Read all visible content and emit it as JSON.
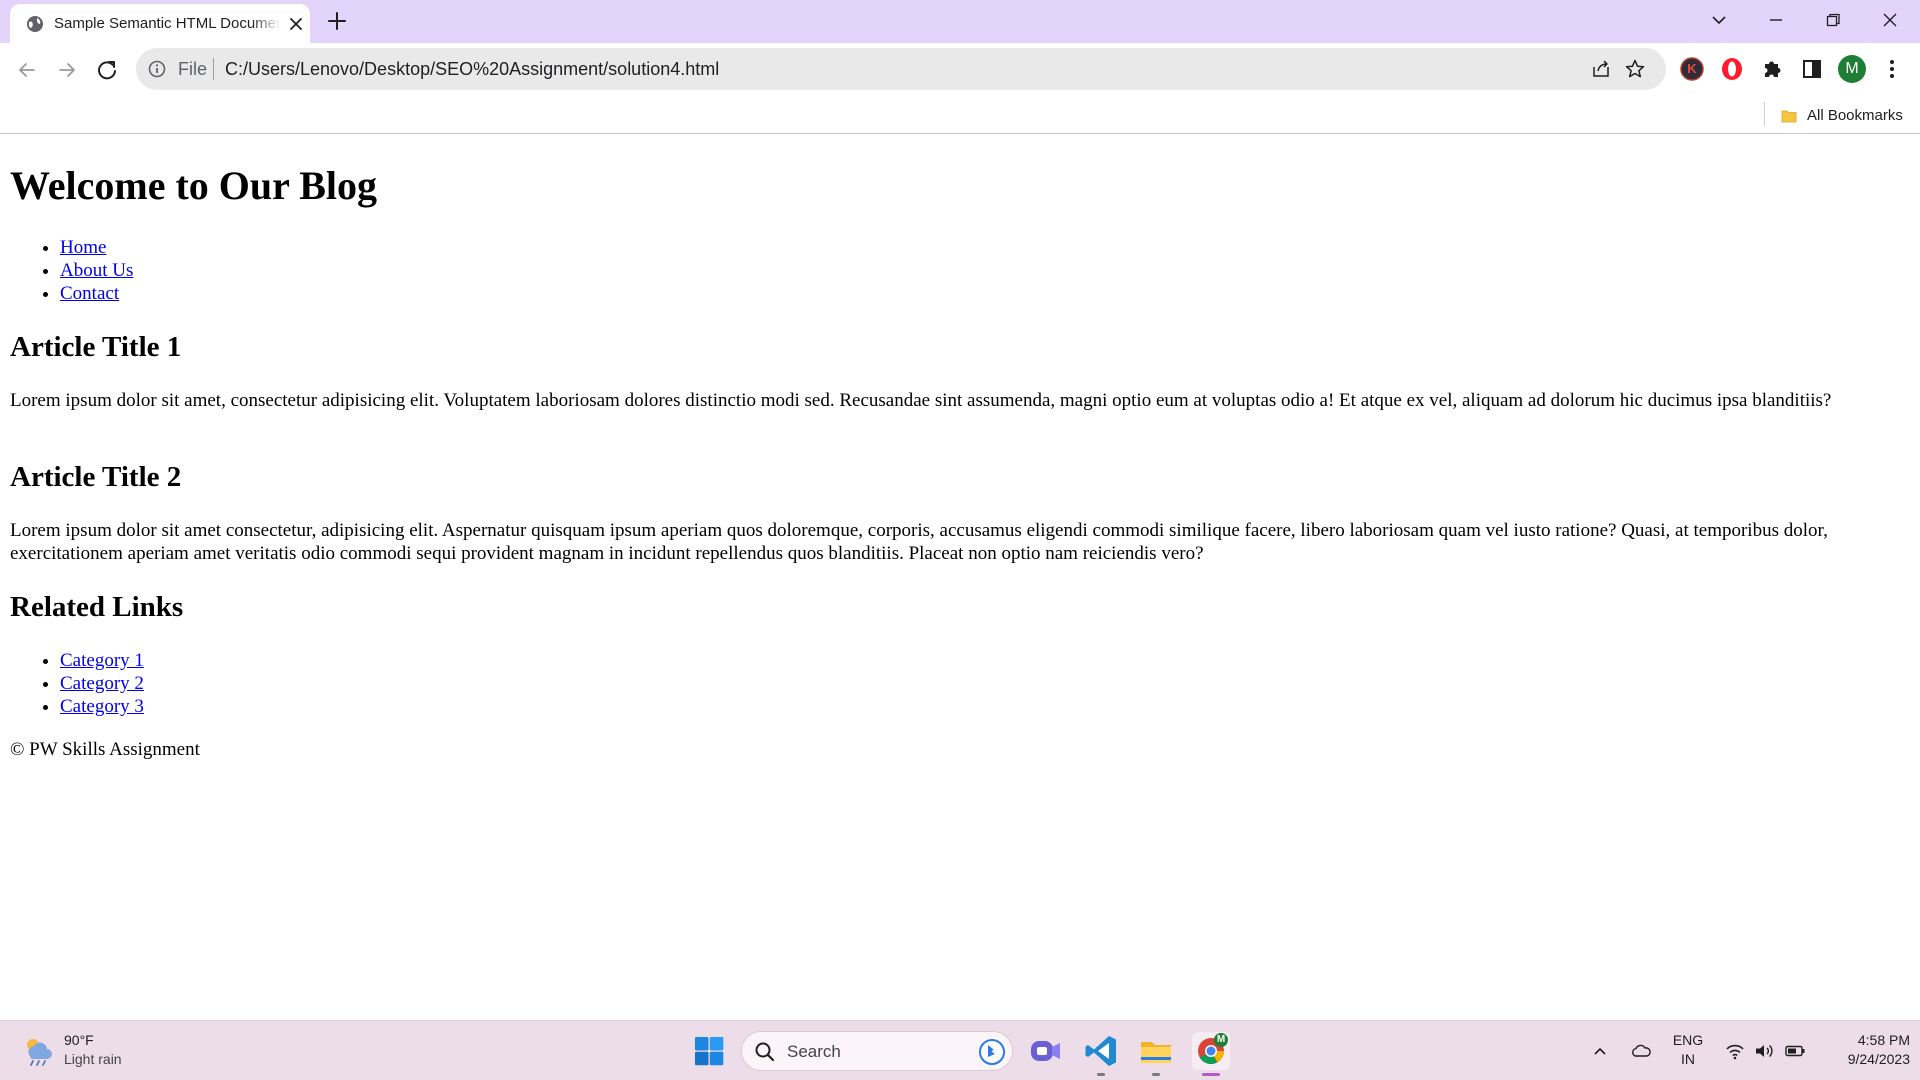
{
  "browser": {
    "tab": {
      "title": "Sample Semantic HTML Document"
    },
    "address_bar": {
      "scheme_label": "File",
      "url": "C:/Users/Lenovo/Desktop/SEO%20Assignment/solution4.html"
    },
    "profile_initial": "M",
    "extension_badge": "K",
    "bookmarks_bar": {
      "folder_label": "All Bookmarks"
    }
  },
  "page": {
    "heading": "Welcome to Our Blog",
    "nav_links": [
      "Home",
      "About Us",
      "Contact"
    ],
    "articles": [
      {
        "title": "Article Title 1",
        "body": "Lorem ipsum dolor sit amet, consectetur adipisicing elit. Voluptatem laboriosam dolores distinctio modi sed. Recusandae sint assumenda, magni optio eum at voluptas odio a! Et atque ex vel, aliquam ad dolorum hic ducimus ipsa blanditiis?"
      },
      {
        "title": "Article Title 2",
        "body": "Lorem ipsum dolor sit amet consectetur, adipisicing elit. Aspernatur quisquam ipsum aperiam quos doloremque, corporis, accusamus eligendi commodi similique facere, libero laboriosam quam vel iusto ratione? Quasi, at temporibus dolor, exercitationem aperiam amet veritatis odio commodi sequi provident magnam in incidunt repellendus quos blanditiis. Placeat non optio nam reiciendis vero?"
      }
    ],
    "related": {
      "heading": "Related Links",
      "links": [
        "Category 1",
        "Category 2",
        "Category 3"
      ]
    },
    "footer": "© PW Skills Assignment"
  },
  "taskbar": {
    "weather": {
      "temperature": "90°F",
      "condition": "Light rain"
    },
    "search_placeholder": "Search",
    "language": {
      "line1": "ENG",
      "line2": "IN"
    },
    "clock": {
      "time": "4:58 PM",
      "date": "9/24/2023"
    },
    "chrome_badge": "M"
  },
  "colors": {
    "tab_strip": "#e3d4fb",
    "link": "#0000ee",
    "taskbar": "#eddde9",
    "profile": "#1e7e34"
  }
}
